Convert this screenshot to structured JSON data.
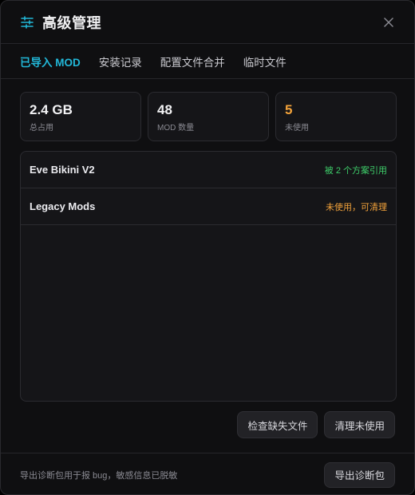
{
  "header": {
    "title": "高级管理",
    "icon": "sliders-icon",
    "close_icon": "close-icon"
  },
  "tabs": [
    {
      "label": "已导入 MOD",
      "active": true
    },
    {
      "label": "安装记录",
      "active": false
    },
    {
      "label": "配置文件合并",
      "active": false
    },
    {
      "label": "临时文件",
      "active": false
    }
  ],
  "stats": [
    {
      "value": "2.4 GB",
      "label": "总占用"
    },
    {
      "value": "48",
      "label": "MOD 数量"
    },
    {
      "value": "5",
      "label": "未使用"
    }
  ],
  "mods": [
    {
      "name": "Eve Bikini V2",
      "status": "被 2 个方案引用"
    },
    {
      "name": "Legacy Mods",
      "status": "未使用，可清理"
    }
  ],
  "actions": {
    "check_missing": "检查缺失文件",
    "clean_unused": "清理未使用"
  },
  "footer": {
    "hint": "导出诊断包用于报 bug，敏感信息已脱敏",
    "export_button": "导出诊断包"
  },
  "colors": {
    "accent": "#22b8d9",
    "warning": "#f2a23a",
    "success": "#3ecf6a"
  }
}
